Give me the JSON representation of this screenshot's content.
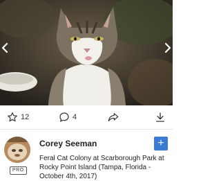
{
  "photo": {
    "subject": "cat photo",
    "prev_icon": "chevron-left-icon",
    "next_icon": "chevron-right-icon"
  },
  "actions": {
    "favorites": {
      "icon": "star-icon",
      "count": "12"
    },
    "comments": {
      "icon": "comment-icon",
      "count": "4"
    },
    "share": {
      "icon": "share-icon"
    },
    "download": {
      "icon": "download-icon"
    }
  },
  "owner": {
    "name": "Corey Seeman",
    "badge": "PRO",
    "follow_label": "+"
  },
  "photo_title": "Feral Cat Colony at Scarborough Park at Rocky Point Island (Tampa, Florida - October 4th, 2017)",
  "colors": {
    "accent": "#3a7bd5",
    "text": "#222222"
  }
}
